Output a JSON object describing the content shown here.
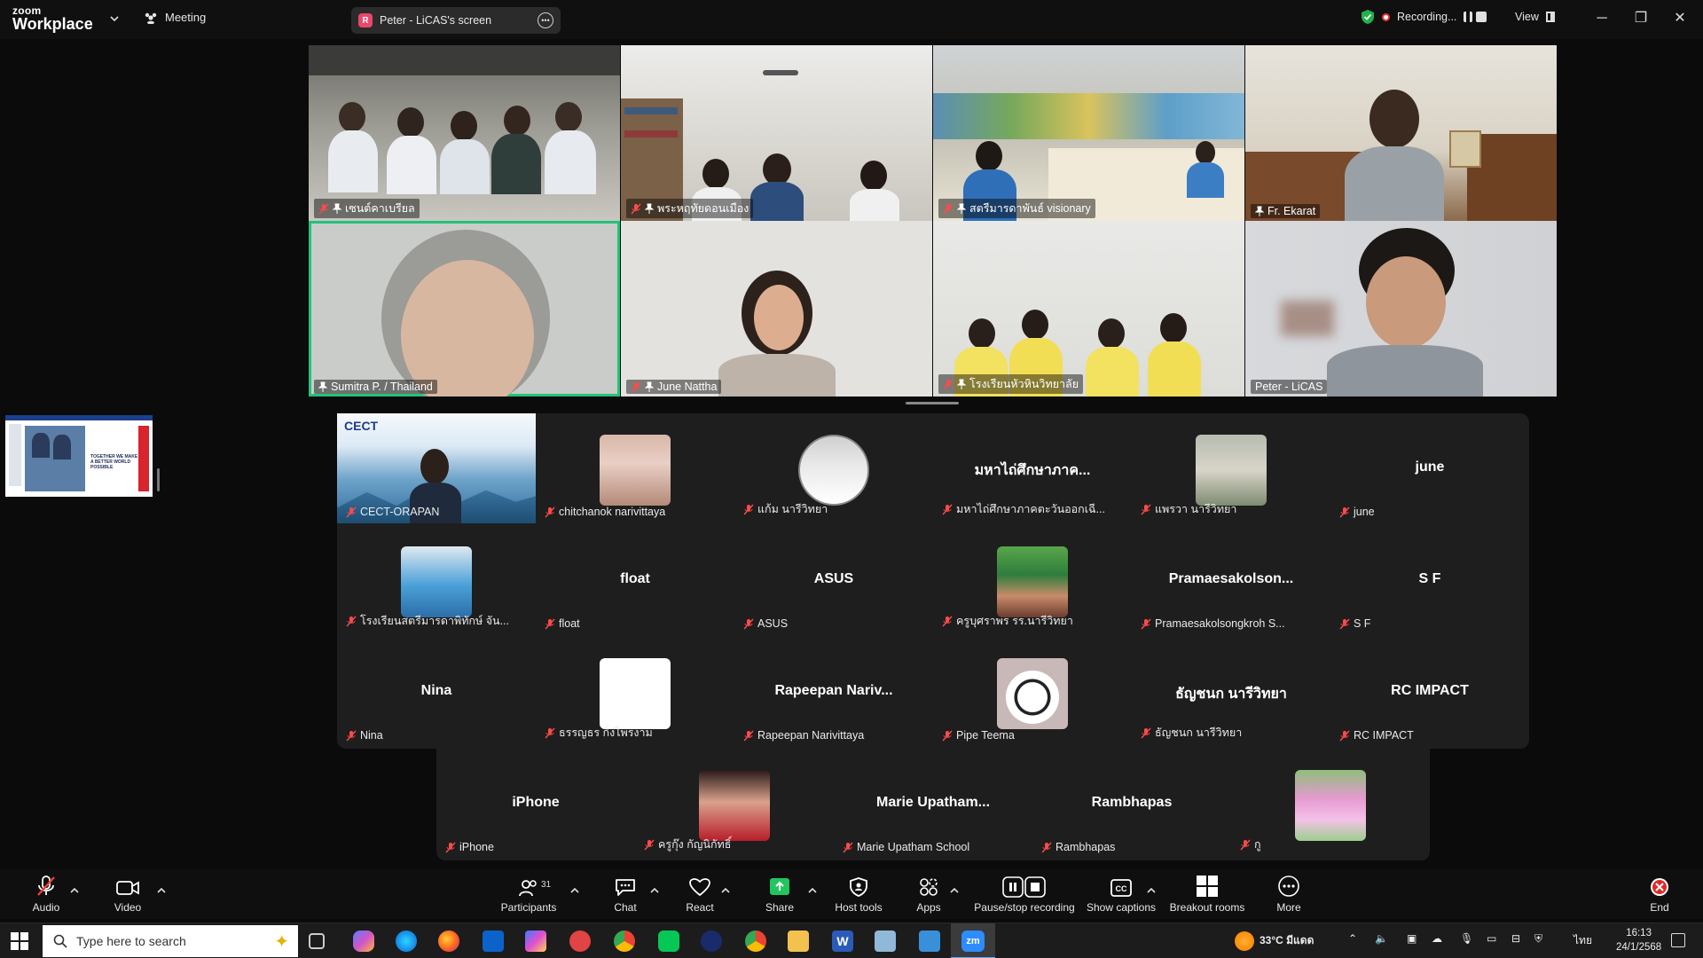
{
  "titlebar": {
    "brand_small": "zoom",
    "brand_large": "Workplace",
    "meeting_label": "Meeting",
    "screen_badge": "R",
    "screen_label": "Peter - LiCAS's screen",
    "recording_label": "Recording...",
    "view_label": "View"
  },
  "videos": [
    {
      "name": "เซนต์คาเบรียล",
      "muted": true,
      "pinned": true
    },
    {
      "name": "พระหฤทัยดอนเมือง",
      "muted": true,
      "pinned": true
    },
    {
      "name": "สตรีมารดาพันธ์ visionary",
      "muted": true,
      "pinned": true
    },
    {
      "name": "Fr. Ekarat",
      "muted": false,
      "pinned": true
    },
    {
      "name": "Sumitra P. / Thailand",
      "muted": false,
      "pinned": true
    },
    {
      "name": "June Nattha",
      "muted": true,
      "pinned": true
    },
    {
      "name": "โรงเรียนหัวหินวิทยาลัย",
      "muted": true,
      "pinned": true
    },
    {
      "name": "Peter - LiCAS",
      "muted": false,
      "pinned": false
    }
  ],
  "gallery": [
    {
      "name": "CECT-ORAPAN",
      "big": "",
      "kind": "cect"
    },
    {
      "name": "chitchanok narivittaya",
      "big": "",
      "kind": "photo1"
    },
    {
      "name": "แก้ม นารีวิทยา",
      "big": "",
      "kind": "photo2"
    },
    {
      "name": "มหาไถ่ศึกษาภาคตะวันออกเฉี...",
      "big": "มหาไถ่ศึกษาภาค...",
      "kind": "text"
    },
    {
      "name": "แพรวา นารีวิทยา",
      "big": "",
      "kind": "photo3"
    },
    {
      "name": "june",
      "big": "june",
      "kind": "text"
    },
    {
      "name": "โรงเรียนสตรีมารดาพิทักษ์ จัน...",
      "big": "",
      "kind": "photo4"
    },
    {
      "name": "float",
      "big": "float",
      "kind": "text"
    },
    {
      "name": "ASUS",
      "big": "ASUS",
      "kind": "text"
    },
    {
      "name": "ครูบุศราพร รร.นารีวิทยา",
      "big": "",
      "kind": "photo5"
    },
    {
      "name": "Pramaesakolsongkroh S...",
      "big": "Pramaesakolson...",
      "kind": "text"
    },
    {
      "name": "S F",
      "big": "S F",
      "kind": "text"
    },
    {
      "name": "Nina",
      "big": "Nina",
      "kind": "text"
    },
    {
      "name": "ธรรญธร กิ่งไพรงาม",
      "big": "",
      "kind": "white"
    },
    {
      "name": "Rapeepan Narivittaya",
      "big": "Rapeepan  Nariv...",
      "kind": "text"
    },
    {
      "name": "Pipe Teema",
      "big": "",
      "kind": "ball"
    },
    {
      "name": "ธัญชนก นารีวิทยา",
      "big": "ธัญชนก นารีวิทยา",
      "kind": "text"
    },
    {
      "name": "RC IMPACT",
      "big": "RC IMPACT",
      "kind": "text"
    }
  ],
  "gallery_row4": [
    {
      "name": "iPhone",
      "big": "iPhone",
      "kind": "text"
    },
    {
      "name": "ครูกุ๊ง กัญนิกัทธิ์",
      "big": "",
      "kind": "photo6"
    },
    {
      "name": "Marie Upatham School",
      "big": "Marie  Upatham...",
      "kind": "text"
    },
    {
      "name": "Rambhapas",
      "big": "Rambhapas",
      "kind": "text"
    },
    {
      "name": "กู",
      "big": "",
      "kind": "flowers"
    }
  ],
  "cect_logo": "CECT",
  "filmstrip_text": "TOGETHER WE MAKE A BETTER WORLD POSSIBLE",
  "toolbar": {
    "audio": "Audio",
    "video": "Video",
    "participants": "Participants",
    "participants_count": "31",
    "chat": "Chat",
    "react": "React",
    "share": "Share",
    "host_tools": "Host tools",
    "apps": "Apps",
    "pause_stop": "Pause/stop recording",
    "captions": "Show captions",
    "breakout": "Breakout rooms",
    "more": "More",
    "end": "End"
  },
  "taskbar": {
    "search_placeholder": "Type here to search",
    "weather": "33°C มีแดด",
    "lang": "ไทย",
    "time": "16:13",
    "date": "24/1/2568"
  }
}
